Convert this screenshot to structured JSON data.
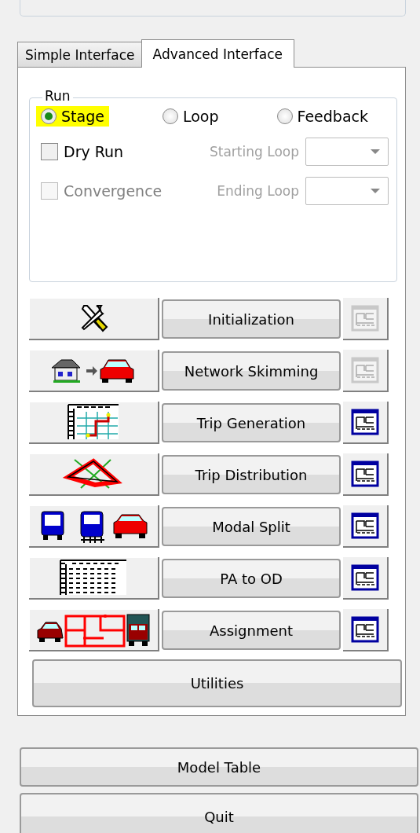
{
  "tabs": [
    {
      "label": "Simple Interface",
      "selected": false
    },
    {
      "label": "Advanced Interface",
      "selected": true
    }
  ],
  "run_group": {
    "title": "Run",
    "modes": [
      {
        "label": "Stage",
        "selected": true,
        "highlighted": true
      },
      {
        "label": "Loop",
        "selected": false,
        "highlighted": false
      },
      {
        "label": "Feedback",
        "selected": false,
        "highlighted": false
      }
    ],
    "options": [
      {
        "label": "Dry Run",
        "checked": false,
        "disabled": false,
        "field_label": "Starting Loop",
        "field_disabled": true
      },
      {
        "label": "Convergence",
        "checked": false,
        "disabled": true,
        "field_label": "Ending Loop",
        "field_disabled": true
      }
    ]
  },
  "steps": [
    {
      "label": "Initialization",
      "window_enabled": false
    },
    {
      "label": "Network Skimming",
      "window_enabled": false
    },
    {
      "label": "Trip Generation",
      "window_enabled": true
    },
    {
      "label": "Trip Distribution",
      "window_enabled": true
    },
    {
      "label": "Modal Split",
      "window_enabled": true
    },
    {
      "label": "PA to OD",
      "window_enabled": true
    },
    {
      "label": "Assignment",
      "window_enabled": true
    }
  ],
  "utilities": "Utilities",
  "buttons": [
    "Model Table",
    "Quit"
  ]
}
